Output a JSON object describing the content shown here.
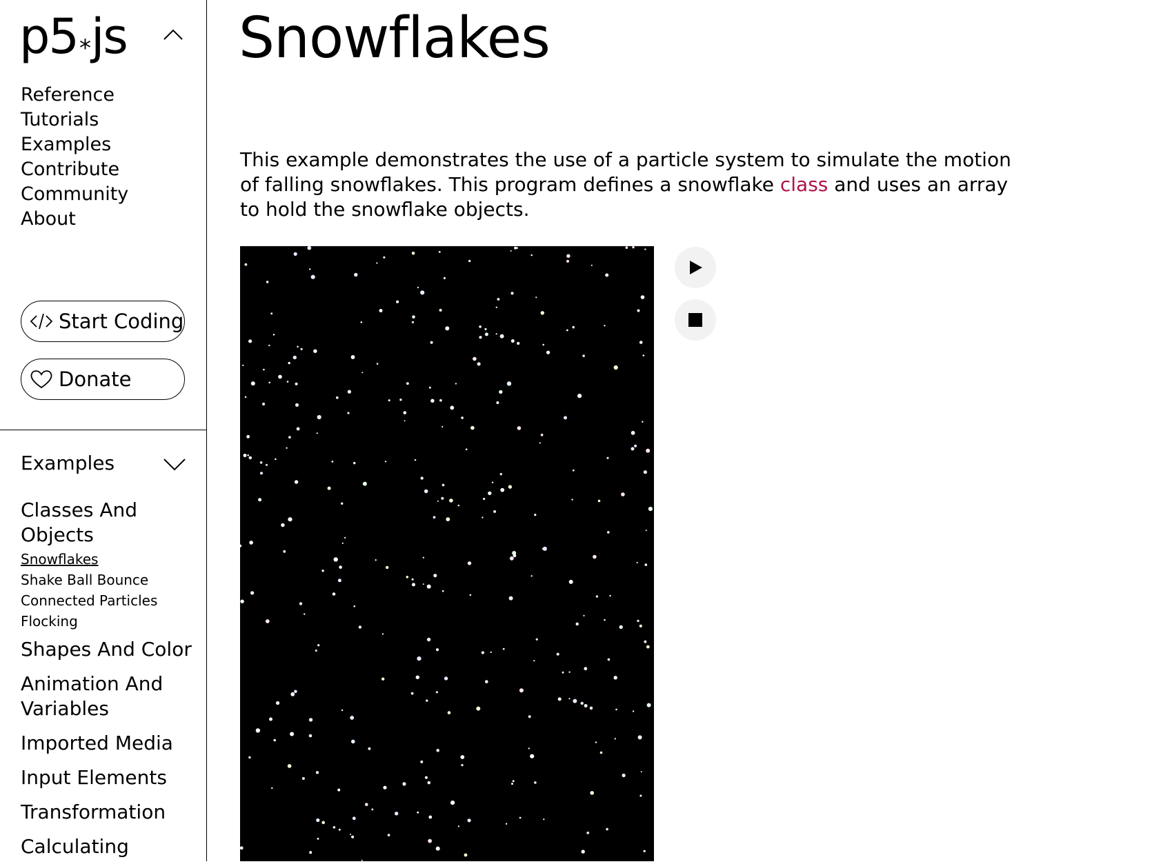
{
  "logo": {
    "left": "p5",
    "star": "*",
    "right": "js"
  },
  "nav": [
    "Reference",
    "Tutorials",
    "Examples",
    "Contribute",
    "Community",
    "About"
  ],
  "buttons": {
    "start_coding": "Start Coding",
    "donate": "Donate"
  },
  "sidebar": {
    "section_title": "Examples",
    "categories": [
      {
        "label": "Classes And Objects",
        "items": [
          "Snowflakes",
          "Shake Ball Bounce",
          "Connected Particles",
          "Flocking"
        ],
        "active": "Snowflakes"
      },
      {
        "label": "Shapes And Color"
      },
      {
        "label": "Animation And Variables"
      },
      {
        "label": "Imported Media"
      },
      {
        "label": "Input Elements"
      },
      {
        "label": "Transformation"
      },
      {
        "label": "Calculating"
      }
    ]
  },
  "page": {
    "title": "Snowflakes",
    "description_before": "This example demonstrates the use of a particle system to simulate the motion of falling snowflakes. This program defines a snowflake ",
    "description_link": "class",
    "description_after": " and uses an array to hold the snowflake objects."
  },
  "controls": {
    "play_icon": "play-icon",
    "stop_icon": "stop-icon"
  },
  "colors": {
    "link": "#b1124a",
    "canvas_bg": "#000000",
    "control_bg": "#f2f2f2"
  }
}
